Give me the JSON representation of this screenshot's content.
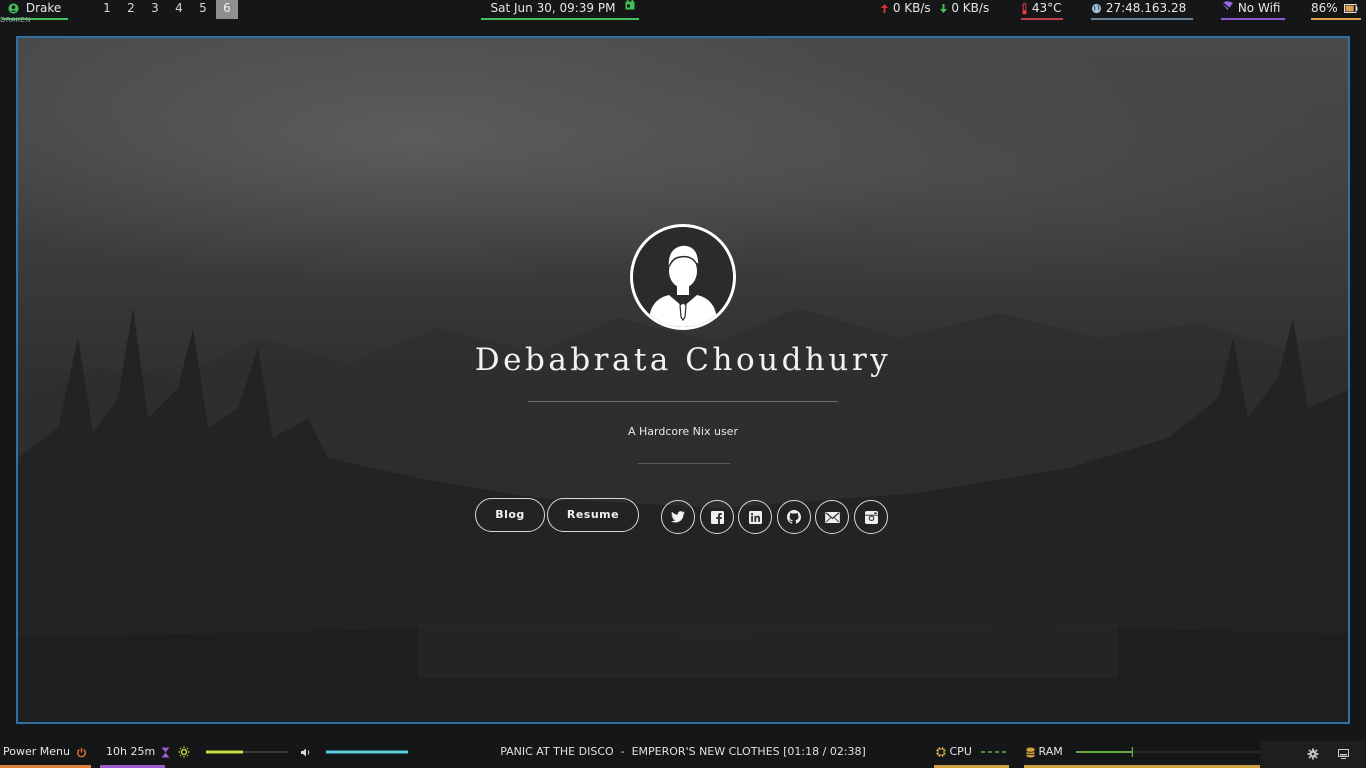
{
  "topbar": {
    "user": {
      "name": "Drake",
      "sub": "DRAKEN"
    },
    "workspaces": [
      {
        "label": "1",
        "active": false
      },
      {
        "label": "2",
        "active": false
      },
      {
        "label": "3",
        "active": false
      },
      {
        "label": "4",
        "active": false
      },
      {
        "label": "5",
        "active": false
      },
      {
        "label": "6",
        "active": true
      }
    ],
    "clock": "Sat Jun 30, 09:39 PM",
    "net": {
      "up": "0 KB/s",
      "down": "0 KB/s"
    },
    "temperature": "43°C",
    "ip": "27:48.163.28",
    "wifi": "No Wifi",
    "battery": "86%",
    "battery_level": 0.86
  },
  "page": {
    "name": "Debabrata Choudhury",
    "tagline": "A Hardcore Nix user",
    "buttons": {
      "blog": "Blog",
      "resume": "Resume"
    },
    "social_icons": [
      "twitter-icon",
      "facebook-icon",
      "linkedin-icon",
      "github-icon",
      "email-icon",
      "instagram-icon"
    ]
  },
  "bottombar": {
    "power_label": "Power Menu",
    "uptime": "10h 25m",
    "brightness_level": 0.45,
    "volume_level": 1.0,
    "now_playing": "PANIC AT THE DISCO  -  EMPEROR'S NEW CLOTHES [01:18 / 02:38]",
    "cpu_label": "CPU",
    "ram_label": "RAM",
    "ram_level": 0.3
  },
  "colors": {
    "accent_green": "#43c05a",
    "window_border": "#2f6ea6",
    "bar_bg": "#141618",
    "brightness": "#c8e040",
    "volume": "#5ad0e0",
    "ram_line": "#7ad050"
  }
}
